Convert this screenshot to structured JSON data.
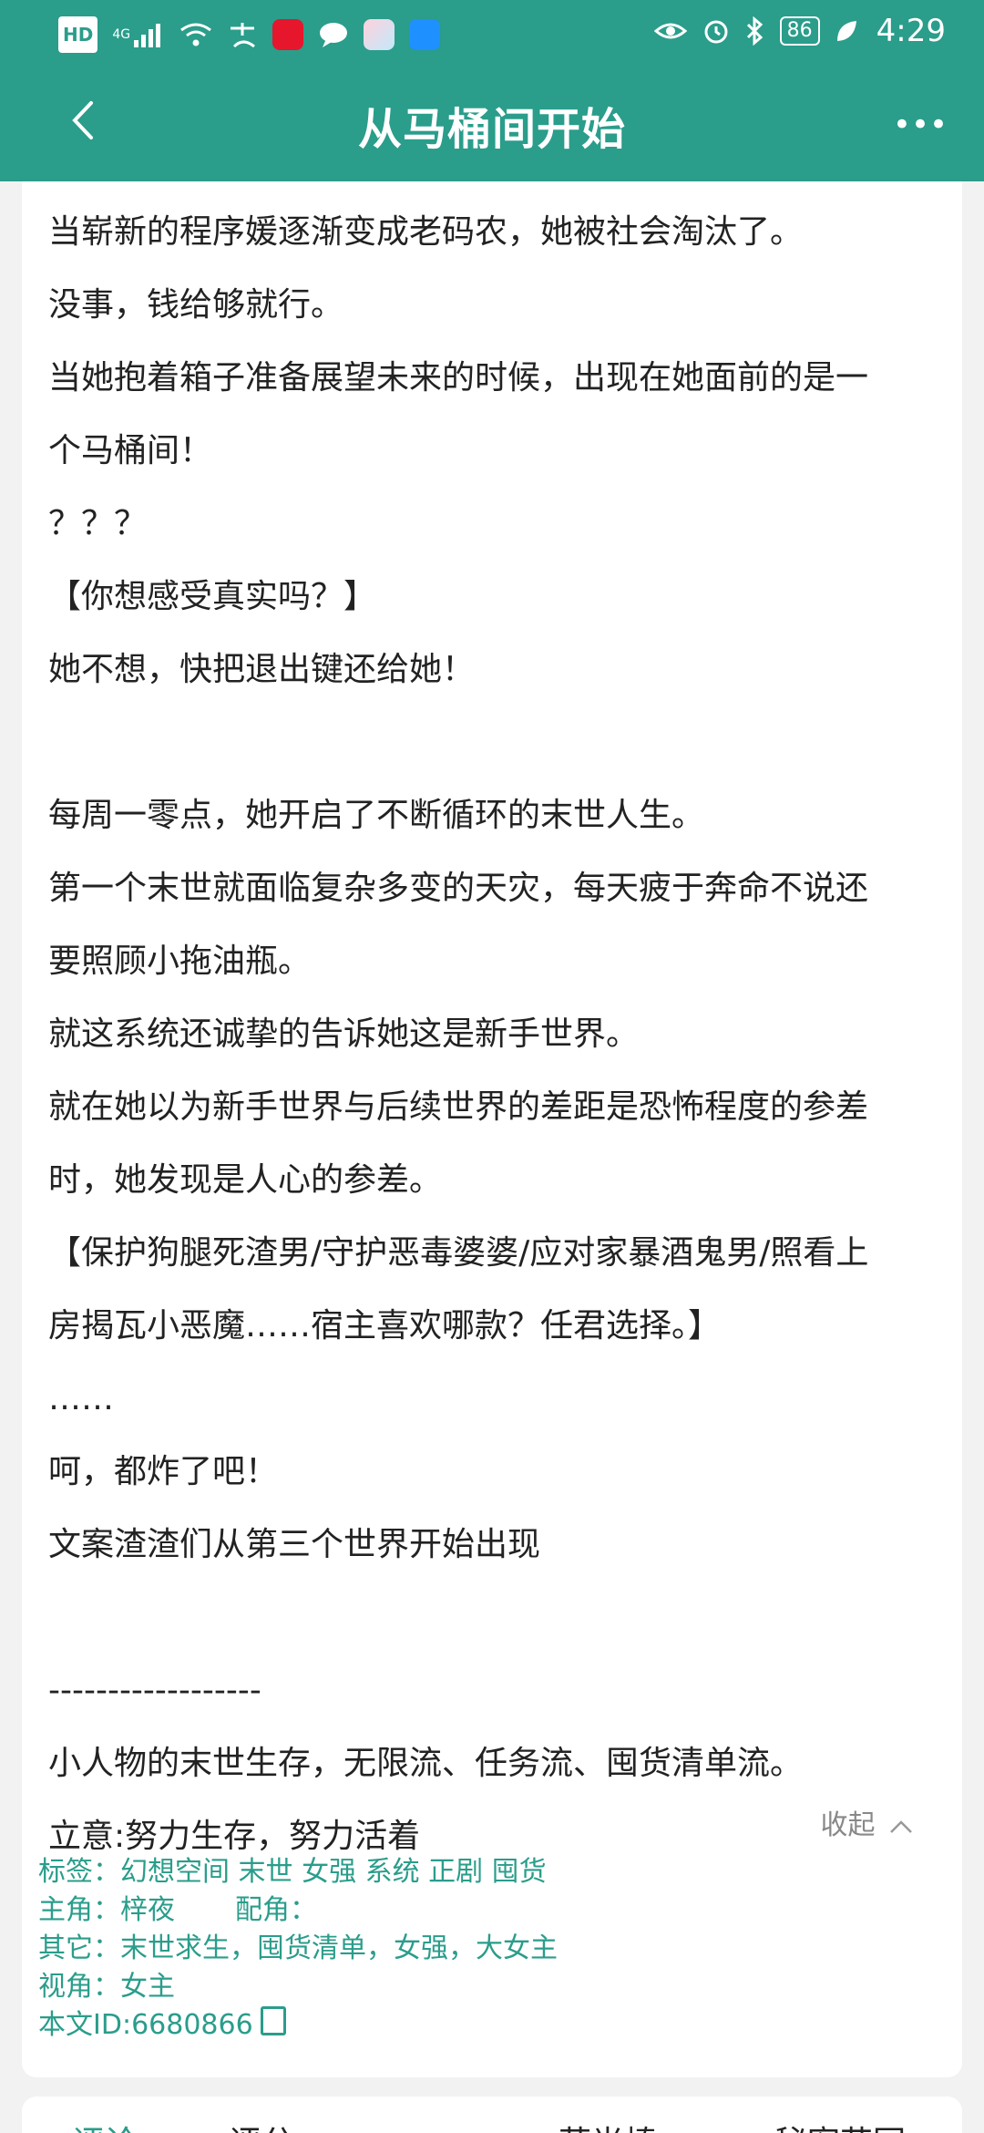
{
  "status_bar": {
    "network_badge": "HD",
    "network_type": "4G",
    "battery": "86",
    "time": "4:29",
    "icons": [
      "hd-icon",
      "signal-icon",
      "wifi-icon",
      "zhifubao-icon",
      "weibo-icon",
      "chat-icon",
      "photo-app-icon",
      "search-app-icon",
      "eye-icon",
      "alarm-icon",
      "bluetooth-icon",
      "battery-icon",
      "leaf-icon"
    ]
  },
  "header": {
    "title": "从马桶间开始",
    "more": "•••"
  },
  "content": {
    "lines": [
      "当崭新的程序媛逐渐变成老码农，她被社会淘汰了。",
      "没事，钱给够就行。",
      "当她抱着箱子准备展望未来的时候，出现在她面前的是一",
      "个马桶间！",
      "？？？",
      "【你想感受真实吗？】",
      "她不想，快把退出键还给她！",
      "",
      "每周一零点，她开启了不断循环的末世人生。",
      "第一个末世就面临复杂多变的天灾，每天疲于奔命不说还",
      "要照顾小拖油瓶。",
      "就这系统还诚挚的告诉她这是新手世界。",
      "就在她以为新手世界与后续世界的差距是恐怖程度的参差",
      "时，她发现是人心的参差。",
      "【保护狗腿死渣男/守护恶毒婆婆/应对家暴酒鬼男/照看上",
      "房揭瓦小恶魔……宿主喜欢哪款？任君选择。】",
      "……",
      "呵，都炸了吧！",
      "文案渣渣们从第三个世界开始出现",
      "",
      "------------------",
      "小人物的末世生存，无限流、任务流、囤货清单流。",
      "立意:努力生存，努力活着"
    ],
    "collapse_label": "收起"
  },
  "meta": {
    "tags_label": "标签：",
    "tags_value": "幻想空间 末世 女强 系统 正剧 囤货",
    "protagonist_label": "主角：",
    "protagonist_value": "梓夜",
    "supporting_label": "配角：",
    "supporting_value": "",
    "other_label": "其它：",
    "other_value": "末世求生，囤货清单，女强，大女主",
    "perspective_label": "视角：",
    "perspective_value": "女主",
    "id_label": "本文ID:",
    "id_value": "6680866"
  },
  "tabs": [
    "评论",
    "评分",
    "荧光棒",
    "秘密花园"
  ],
  "colors": {
    "accent": "#2a9d8b",
    "background": "#f2f2f2",
    "card": "#ffffff",
    "text": "#222222",
    "muted": "#888888"
  }
}
